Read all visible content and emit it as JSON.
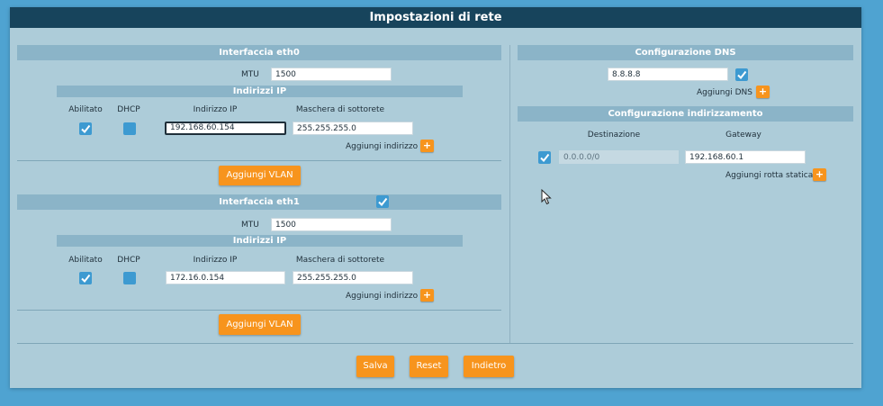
{
  "title": "Impostazioni di rete",
  "eth0": {
    "header": "Interfaccia eth0",
    "mtu_label": "MTU",
    "mtu": "1500",
    "addresses_header": "Indirizzi IP",
    "col_enabled": "Abilitato",
    "col_dhcp": "DHCP",
    "col_ip": "Indirizzo IP",
    "col_mask": "Maschera di sottorete",
    "row": {
      "enabled": true,
      "dhcp": false,
      "ip": "192.168.60.154",
      "mask": "255.255.255.0"
    },
    "add_address": "Aggiungi indirizzo",
    "add_vlan": "Aggiungi VLAN"
  },
  "eth1": {
    "header": "Interfaccia eth1",
    "header_checked": true,
    "mtu_label": "MTU",
    "mtu": "1500",
    "addresses_header": "Indirizzi IP",
    "col_enabled": "Abilitato",
    "col_dhcp": "DHCP",
    "col_ip": "Indirizzo IP",
    "col_mask": "Maschera di sottorete",
    "row": {
      "enabled": true,
      "dhcp": false,
      "ip": "172.16.0.154",
      "mask": "255.255.255.0"
    },
    "add_address": "Aggiungi indirizzo",
    "add_vlan": "Aggiungi VLAN"
  },
  "dns": {
    "header": "Configurazione DNS",
    "server": "8.8.8.8",
    "enabled": true,
    "add_dns": "Aggiungi DNS"
  },
  "routing": {
    "header": "Configurazione indirizzamento",
    "col_destination": "Destinazione",
    "col_gateway": "Gateway",
    "row": {
      "enabled": true,
      "destination": "0.0.0.0/0",
      "gateway": "192.168.60.1"
    },
    "add_route": "Aggiungi rotta statica"
  },
  "buttons": {
    "save": "Salva",
    "reset": "Reset",
    "back": "Indietro"
  },
  "plus_symbol": "+",
  "colors": {
    "header": "#17445c",
    "panel": "#adccd9",
    "bar": "#8bb4c8",
    "accent": "#f7941d",
    "checkbox": "#3d9ad1",
    "page_bg": "#4fa3d1"
  }
}
